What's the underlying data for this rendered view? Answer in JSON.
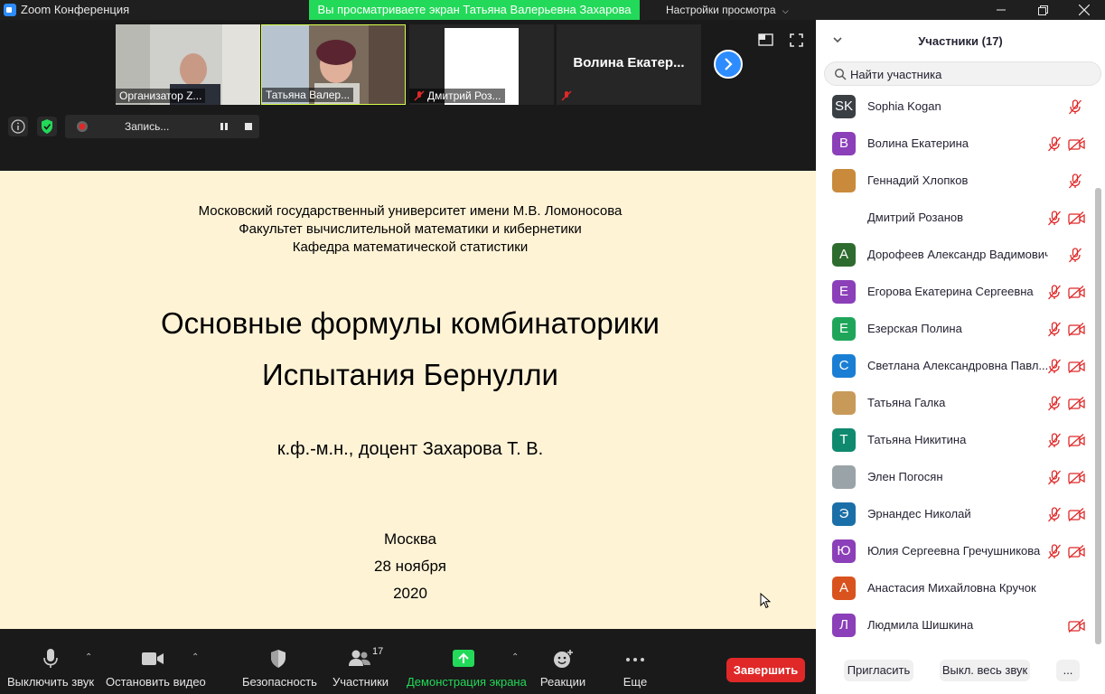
{
  "window": {
    "title": "Zoom Конференция",
    "share_banner": "Вы просматриваете экран Татьяна Валерьевна Захарова",
    "view_settings": "Настройки просмотра"
  },
  "thumbnails": [
    {
      "name": "Организатор Z..."
    },
    {
      "name": "Татьяна Валер..."
    },
    {
      "name": "Дмитрий Роз..."
    },
    {
      "name": "Волина Екатер..."
    }
  ],
  "recording": {
    "label": "Запись..."
  },
  "slide": {
    "line1": "Московский государственный университет имени М.В. Ломоносова",
    "line2": "Факультет вычислительной математики и кибернетики",
    "line3": "Кафедра математической статистики",
    "title1": "Основные формулы комбинаторики",
    "title2": "Испытания Бернулли",
    "author": "к.ф.-м.н., доцент  Захарова Т. В.",
    "city": "Москва",
    "date": "28 ноября",
    "year": "2020"
  },
  "toolbar": {
    "mute": "Выключить звук",
    "video": "Остановить видео",
    "security": "Безопасность",
    "participants": "Участники",
    "participants_count": "17",
    "share": "Демонстрация экрана",
    "reactions": "Реакции",
    "more": "Еще",
    "end": "Завершить"
  },
  "panel": {
    "title": "Участники (17)",
    "search_placeholder": "Найти участника",
    "invite": "Пригласить",
    "mute_all": "Выкл. весь звук",
    "more": "...",
    "participants": [
      {
        "name": "Sophia Kogan",
        "initial": "SK",
        "color": "#3a3f44",
        "mic_muted": true,
        "video_off": false
      },
      {
        "name": "Волина Екатерина",
        "initial": "В",
        "color": "#8b3fb8",
        "mic_muted": true,
        "video_off": true
      },
      {
        "name": "Геннадий Хлопков",
        "initial": "",
        "color": "#c98a3c",
        "mic_muted": true,
        "video_off": false
      },
      {
        "name": "Дмитрий Розанов",
        "initial": "",
        "color": "#ffffff",
        "mic_muted": true,
        "video_off": true
      },
      {
        "name": "Дорофеев Александр Вадимович",
        "initial": "А",
        "color": "#2e6b2e",
        "mic_muted": true,
        "video_off": false
      },
      {
        "name": "Егорова Екатерина Сергеевна",
        "initial": "Е",
        "color": "#8b3fb8",
        "mic_muted": true,
        "video_off": true
      },
      {
        "name": "Езерская Полина",
        "initial": "Е",
        "color": "#1fa55a",
        "mic_muted": true,
        "video_off": true
      },
      {
        "name": "Светлана Александровна Павл...",
        "initial": "С",
        "color": "#1a7fd4",
        "mic_muted": true,
        "video_off": true
      },
      {
        "name": "Татьяна Галка",
        "initial": "",
        "color": "#c89a5a",
        "mic_muted": true,
        "video_off": true
      },
      {
        "name": "Татьяна Никитина",
        "initial": "Т",
        "color": "#0f8a6e",
        "mic_muted": true,
        "video_off": true
      },
      {
        "name": "Элен Погосян",
        "initial": "",
        "color": "#9aa3a8",
        "mic_muted": true,
        "video_off": true
      },
      {
        "name": "Эрнандес Николай",
        "initial": "Э",
        "color": "#1b6fa8",
        "mic_muted": true,
        "video_off": true
      },
      {
        "name": "Юлия Сергеевна Гречушникова",
        "initial": "Ю",
        "color": "#8b3fb8",
        "mic_muted": true,
        "video_off": true
      },
      {
        "name": "Анастасия Михайловна Кручок",
        "initial": "А",
        "color": "#d9531e",
        "mic_muted": false,
        "video_off": false
      },
      {
        "name": "Людмила Шишкина",
        "initial": "Л",
        "color": "#8b3fb8",
        "mic_muted": false,
        "video_off": true
      }
    ]
  },
  "colors": {
    "accent": "#2d8cff",
    "share_green": "#23d959",
    "end_red": "#e02828",
    "slide_bg": "#fff3d6",
    "muted_red": "#e02828"
  }
}
